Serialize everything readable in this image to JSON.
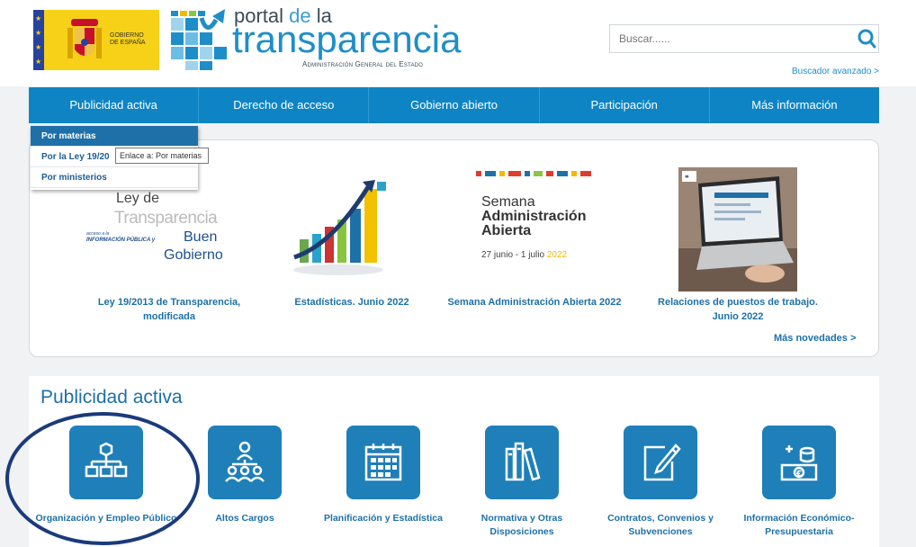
{
  "header": {
    "gov_line1": "GOBIERNO",
    "gov_line2": "DE ESPAÑA",
    "portal_word": "portal",
    "de_word": "de",
    "la_word": "la",
    "transparencia_word": "transparencia",
    "subtitle": "Administración General del Estado",
    "search_placeholder": "Buscar......",
    "advanced_search": "Buscador avanzado >"
  },
  "nav": [
    "Publicidad activa",
    "Derecho de acceso",
    "Gobierno abierto",
    "Participación",
    "Más información"
  ],
  "dropdown": [
    "Por materias",
    "Por la Ley 19/20",
    "Por ministerios"
  ],
  "tooltip": "Enlace a: Por materias",
  "novedades": {
    "items": [
      {
        "caption": "Ley 19/2013 de Transparencia, modificada",
        "img": {
          "l1": "Ley de",
          "l2": "Transparencia",
          "l3a": "acceso a la",
          "l3b": "INFORMACIÓN PÚBLICA y",
          "l3c": "Buen",
          "l4": "Gobierno"
        }
      },
      {
        "caption": "Estadísticas. Junio 2022"
      },
      {
        "caption": "Semana Administración Abierta 2022",
        "img": {
          "w1": "Semana",
          "w2": "Administración",
          "w3": "Abierta",
          "date_a": "27 junio - 1 julio ",
          "date_b": "2022"
        }
      },
      {
        "caption": "Relaciones de puestos de trabajo. Junio 2022"
      }
    ],
    "more": "Más novedades >"
  },
  "publicidad": {
    "title": "Publicidad activa",
    "tiles": [
      {
        "label": "Organización y Empleo Público",
        "icon": "org-chart-icon"
      },
      {
        "label": "Altos Cargos",
        "icon": "people-hierarchy-icon"
      },
      {
        "label": "Planificación y Estadística",
        "icon": "calendar-icon"
      },
      {
        "label": "Normativa y Otras Disposiciones",
        "icon": "books-icon"
      },
      {
        "label": "Contratos, Convenios y Subvenciones",
        "icon": "document-pen-icon"
      },
      {
        "label": "Información Económico-Presupuestaria",
        "icon": "money-icon"
      }
    ]
  },
  "colors": {
    "nav_blue": "#0e84c4",
    "tile_blue": "#1e7fb9",
    "link_blue": "#1e70a8",
    "circle": "#1a3b7b",
    "gov_yellow": "#f7d117"
  }
}
